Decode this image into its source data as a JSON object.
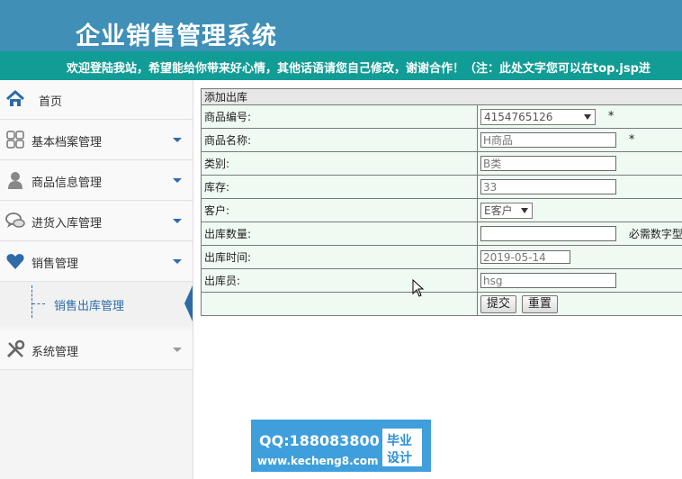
{
  "header": {
    "title": "企业销售管理系统"
  },
  "marquee": {
    "text": "欢迎登陆我站，希望能给你带来好心情，其他话语请您自己修改，谢谢合作！（注：此处文字您可以在top.jsp进"
  },
  "sidebar": {
    "items": [
      {
        "label": "首页",
        "icon": "home-icon"
      },
      {
        "label": "基本档案管理",
        "icon": "grid-icon"
      },
      {
        "label": "商品信息管理",
        "icon": "user-icon"
      },
      {
        "label": "进货入库管理",
        "icon": "chat-icon"
      },
      {
        "label": "销售管理",
        "icon": "heart-icon"
      },
      {
        "label": "系统管理",
        "icon": "tools-icon"
      }
    ],
    "subitem": {
      "label": "销售出库管理"
    }
  },
  "form": {
    "caption": "添加出库",
    "fields": {
      "code": {
        "label": "商品编号:",
        "value": "4154765126",
        "star": "*"
      },
      "name": {
        "label": "商品名称:",
        "value": "H商品",
        "star": "*"
      },
      "category": {
        "label": "类别:",
        "value": "B类"
      },
      "stock": {
        "label": "库存:",
        "value": "33"
      },
      "customer": {
        "label": "客户:",
        "value": "E客户"
      },
      "qty": {
        "label": "出库数量:",
        "value": "",
        "hint": "必需数字型"
      },
      "time": {
        "label": "出库时间:",
        "value": "2019-05-14"
      },
      "operator": {
        "label": "出库员:",
        "value": "hsg"
      }
    },
    "submit": "提交",
    "reset": "重置"
  },
  "watermark": {
    "qq": "QQ:188083800",
    "site": "www.kecheng8.com",
    "badge_line1": "毕业",
    "badge_line2": "设计"
  },
  "colors": {
    "header": "#3f8fb7",
    "marquee": "#119c95",
    "accent": "#2e6ba8",
    "watermark": "#3f9fdc"
  }
}
